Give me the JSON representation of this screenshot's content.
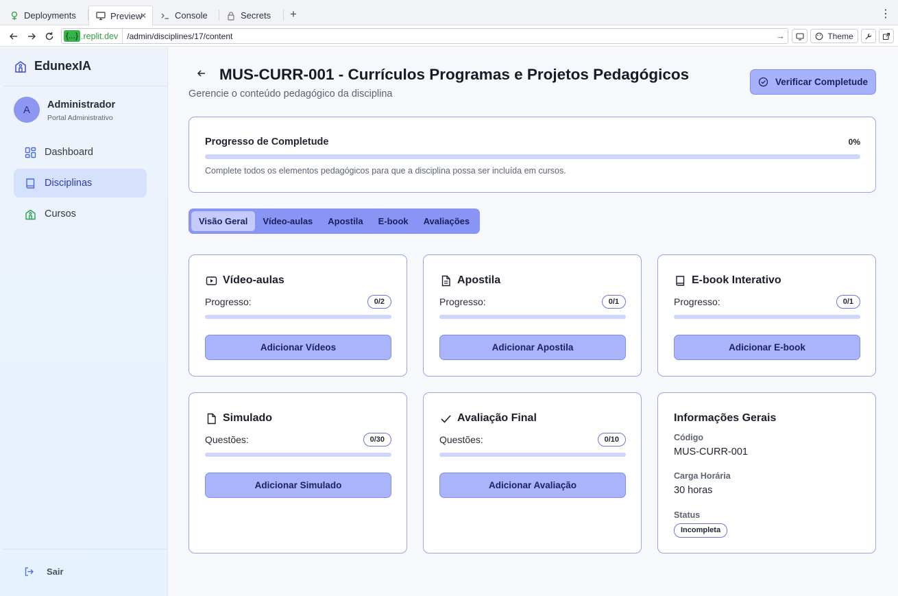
{
  "browser": {
    "tabs": [
      {
        "label": "Deployments",
        "icon": "deployments-icon"
      },
      {
        "label": "Preview",
        "icon": "monitor-icon"
      },
      {
        "label": "Console",
        "icon": "terminal-icon"
      },
      {
        "label": "Secrets",
        "icon": "lock-icon"
      }
    ],
    "url_host_tag": "{...}",
    "url_domain": ".replit.dev",
    "url_path": "/admin/disciplines/17/content",
    "theme_label": "Theme"
  },
  "sidebar": {
    "brand": "EdunexIA",
    "user": {
      "initial": "A",
      "name": "Administrador",
      "role": "Portal Administrativo"
    },
    "items": [
      {
        "label": "Dashboard",
        "icon": "dashboard-icon",
        "active": false
      },
      {
        "label": "Disciplinas",
        "icon": "book-icon",
        "active": true
      },
      {
        "label": "Cursos",
        "icon": "school-icon",
        "active": false
      }
    ],
    "logout_label": "Sair"
  },
  "page": {
    "title": "MUS-CURR-001 - Currículos Programas e Projetos Pedagógicos",
    "subtitle": "Gerencie o conteúdo pedagógico da disciplina",
    "verify_button": "Verificar Completude"
  },
  "progress": {
    "title": "Progresso de Completude",
    "percent_label": "0%",
    "percent": 0,
    "note": "Complete todos os elementos pedagógicos para que a disciplina possa ser incluída em cursos."
  },
  "tabs": [
    {
      "label": "Visão Geral",
      "active": true
    },
    {
      "label": "Vídeo-aulas",
      "active": false
    },
    {
      "label": "Apostila",
      "active": false
    },
    {
      "label": "E-book",
      "active": false
    },
    {
      "label": "Avaliações",
      "active": false
    }
  ],
  "cards": {
    "videos": {
      "title": "Vídeo-aulas",
      "label": "Progresso:",
      "badge": "0/2",
      "fraction": 0,
      "button": "Adicionar Vídeos",
      "icon": "video-icon"
    },
    "apostila": {
      "title": "Apostila",
      "label": "Progresso:",
      "badge": "0/1",
      "fraction": 0,
      "button": "Adicionar Apostila",
      "icon": "document-icon"
    },
    "ebook": {
      "title": "E-book Interativo",
      "label": "Progresso:",
      "badge": "0/1",
      "fraction": 0,
      "button": "Adicionar E-book",
      "icon": "book-icon"
    },
    "simulado": {
      "title": "Simulado",
      "label": "Questões:",
      "badge": "0/30",
      "fraction": 0,
      "button": "Adicionar Simulado",
      "icon": "file-icon"
    },
    "avaliacao": {
      "title": "Avaliação Final",
      "label": "Questões:",
      "badge": "0/10",
      "fraction": 0,
      "button": "Adicionar Avaliação",
      "icon": "check-icon"
    }
  },
  "info": {
    "title": "Informações Gerais",
    "codigo_label": "Código",
    "codigo": "MUS-CURR-001",
    "carga_label": "Carga Horária",
    "carga": "30 horas",
    "status_label": "Status",
    "status": "Incompleta"
  },
  "colors": {
    "accent": "#8995f5",
    "button": "#a9b4fb",
    "border": "#9aa3ef",
    "active_nav": "#d6e2fb"
  }
}
